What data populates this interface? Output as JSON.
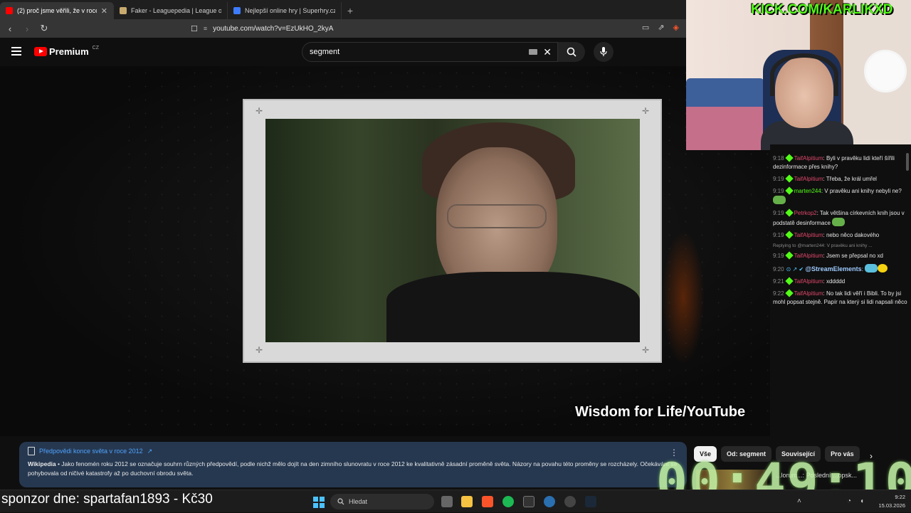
{
  "browser": {
    "tabs": [
      {
        "title": "(2) proč jsme věřili, že v roce 20...",
        "active": true,
        "favicon_color": "#ff0000"
      },
      {
        "title": "Faker - Leaguepedia | League of Leg...",
        "active": false,
        "favicon_color": "#c8aa6e"
      },
      {
        "title": "Nejlepší online hry | Superhry.cz",
        "active": false,
        "favicon_color": "#3d7cff"
      }
    ],
    "new_tab_label": "+",
    "url": "youtube.com/watch?v=EzUkHO_2kyA"
  },
  "youtube": {
    "logo_text": "Premium",
    "country": "CZ",
    "search_value": "segment"
  },
  "video": {
    "caption": "Wisdom for Life/YouTube"
  },
  "stream": {
    "kick_text": "KICK.COM/KARLIKXD",
    "sponsor": "sponzor dne: spartafan1893 - Kč30",
    "timer": "00:49:10"
  },
  "chat": {
    "messages": [
      {
        "time": "9:18",
        "user": "TaifAlpitium",
        "text": "Byli v pravěku lidi kteří šířili dezinformace přes knihy?",
        "color": "red"
      },
      {
        "time": "9:19",
        "user": "TaifAlpitium",
        "text": "Třeba, že král umřel",
        "color": "red"
      },
      {
        "time": "9:19",
        "user": "marten244",
        "text": "V pravěku ani knihy nebyli ne?",
        "color": "green"
      },
      {
        "time": "9:19",
        "user": "Petrkop2",
        "text": "Tak většina církevních knih jsou v podstatě desinformace",
        "color": "red"
      },
      {
        "time": "9:19",
        "user": "TaifAlpitium",
        "text": "nebo něco dakového",
        "color": "red"
      },
      {
        "time": "9:19",
        "user": "TaifAlpitium",
        "text": "Jsem se přepsal no xd",
        "color": "red",
        "reply": "Replying to @marten244: V pravěku ani knihy ..."
      },
      {
        "time": "9:20",
        "user": "@StreamElements",
        "text": "",
        "color": "se"
      },
      {
        "time": "9:21",
        "user": "TaifAlpitium",
        "text": "xddddd",
        "color": "red"
      },
      {
        "time": "9:22",
        "user": "TaifAlpitium",
        "text": "No tak lidi věří i Bibli. To by jsi mohl popsat stejně. Papír na který si lidi napsali něco",
        "color": "red"
      }
    ]
  },
  "wiki_panel": {
    "title": "Předpovědi konce světa v roce 2012",
    "source": "Wikipedia",
    "body": " • Jako fenomén roku 2012 se označuje souhrn různých předpovědí, podle nichž mělo dojít na den zimního slunovratu v roce 2012 ke kvalitativně zásadní proměně světa. Názory na povahu této proměny se rozcházely. Očekávání se pohybovala od ničivé katastrofy až po duchovní obrodu světa."
  },
  "chips": [
    "Vše",
    "Od: segment",
    "Související",
    "Pro vás"
  ],
  "recommendation": {
    "text": "...lorum...: Poslední ...opsk..."
  },
  "taskbar": {
    "search_placeholder": "Hledat",
    "time": "9:22",
    "date": "15.03.2026"
  },
  "colors": {
    "accent": "#4fa3ff",
    "kick_green": "#53fc18",
    "yt_red": "#ff0000"
  }
}
